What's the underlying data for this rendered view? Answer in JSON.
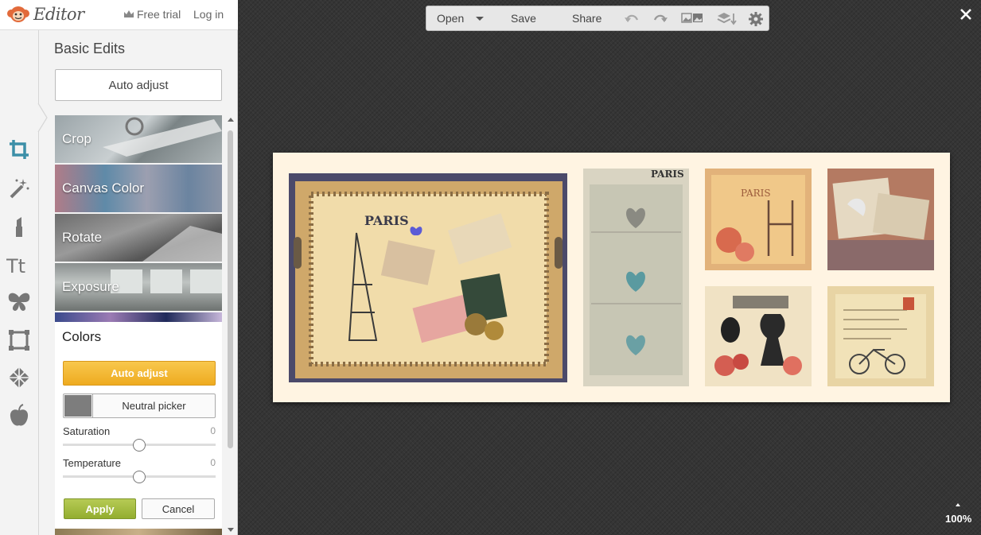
{
  "header": {
    "app_name": "Editor",
    "free_trial": "Free trial",
    "log_in": "Log in"
  },
  "panel": {
    "title": "Basic Edits",
    "auto_adjust": "Auto adjust",
    "tiles": [
      "Crop",
      "Canvas Color",
      "Rotate",
      "Exposure"
    ]
  },
  "colors": {
    "title": "Colors",
    "auto_adjust": "Auto adjust",
    "neutral_picker": "Neutral picker",
    "saturation_label": "Saturation",
    "saturation_value": "0",
    "temperature_label": "Temperature",
    "temperature_value": "0",
    "apply": "Apply",
    "cancel": "Cancel"
  },
  "toolbar": {
    "open": "Open",
    "save": "Save",
    "share": "Share"
  },
  "photos": {
    "tray_text": "PARIS",
    "heart_text": "PARIS",
    "chair_text": "PARIS"
  },
  "zoom": "100%",
  "colors_palette": {
    "accent_orange": "#f2b635",
    "accent_green": "#a3bb3f",
    "tool_active": "#3c8fa8"
  }
}
